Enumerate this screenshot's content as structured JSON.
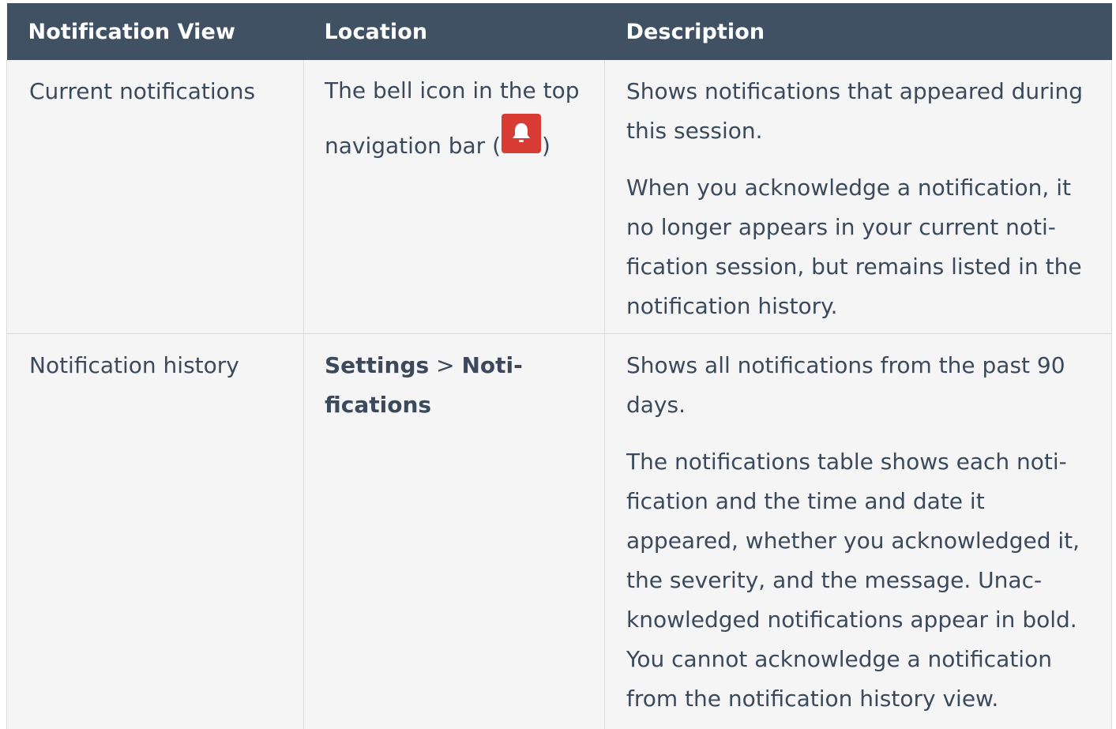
{
  "table": {
    "headers": [
      "Notification View",
      "Location",
      "Description"
    ],
    "rows": [
      {
        "view": "Current notifications",
        "location_text_before": "The bell icon in the top navigation bar (",
        "location_icon": "bell-icon",
        "location_text_after": ")",
        "description": [
          "Shows notifications that appeared during this session.",
          "When you acknowledge a notification, it no longer appears in your current noti­fication session, but remains listed in the notification history."
        ]
      },
      {
        "view": "Notification history",
        "location_bold_1": "Settings",
        "location_separator": " > ",
        "location_bold_2": "Noti­fications",
        "description": [
          "Shows all notifications from the past 90 days.",
          "The notifications table shows each noti­fication and the time and date it appeared, whether you acknowledged it, the severity, and the message. Unac­knowledged notifications appear in bold. You cannot acknowledge a notification from the notification history view."
        ]
      }
    ]
  },
  "colors": {
    "header_bg": "#3f5163",
    "header_text": "#ffffff",
    "row_bg": "#f5f5f5",
    "body_text": "#3a4a5c",
    "bell_bg": "#d93c35"
  }
}
